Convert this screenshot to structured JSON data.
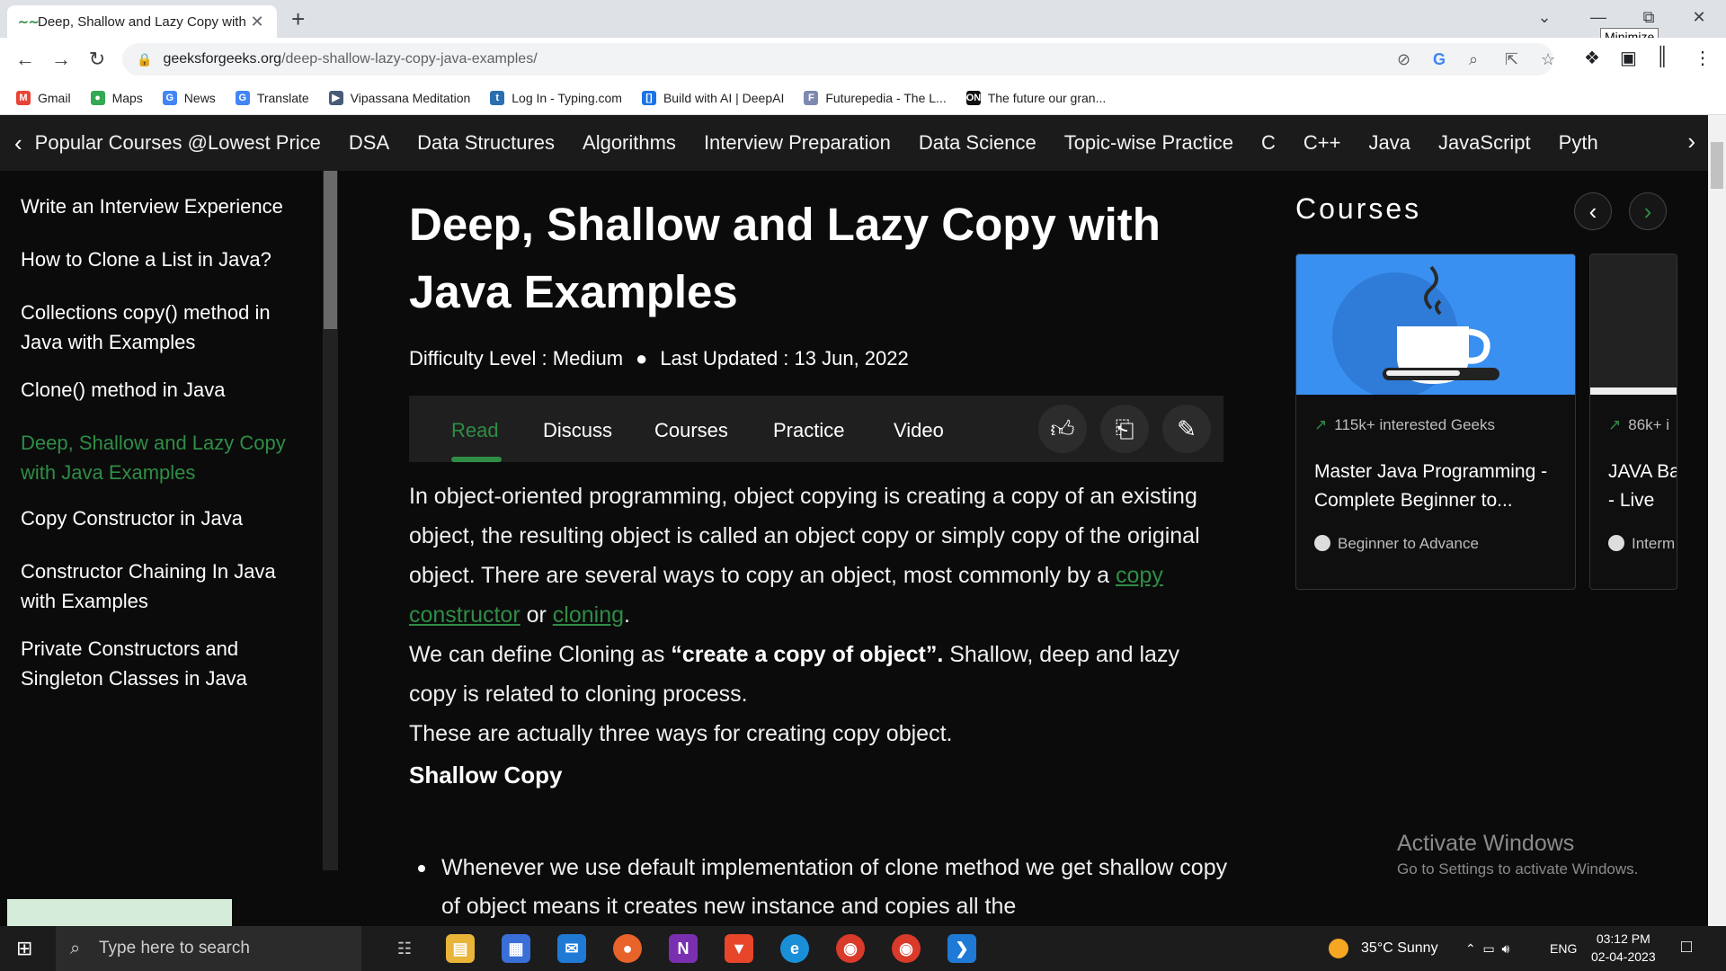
{
  "browser": {
    "tab_title": "Deep, Shallow and Lazy Copy with Java Examples",
    "tab_icon": "gfg-favicon",
    "new_tab": "+",
    "close_tab": "✕",
    "tooltip": "Minimize",
    "url_host": "geeksforgeeks.org",
    "url_path": "/deep-shallow-lazy-copy-java-examples/"
  },
  "bookmarks": [
    {
      "label": "Gmail",
      "icon": "gmail-icon",
      "color": "#ea4335",
      "glyph": "M"
    },
    {
      "label": "Maps",
      "icon": "maps-icon",
      "color": "#34a853",
      "glyph": "●"
    },
    {
      "label": "News",
      "icon": "news-icon",
      "color": "#4285f4",
      "glyph": "G"
    },
    {
      "label": "Translate",
      "icon": "translate-icon",
      "color": "#4285f4",
      "glyph": "G"
    },
    {
      "label": "Vipassana Meditation",
      "icon": "vipassana-icon",
      "color": "#4a5b7a",
      "glyph": "▶"
    },
    {
      "label": "Log In - Typing.com",
      "icon": "typing-icon",
      "color": "#2a6fb0",
      "glyph": "t"
    },
    {
      "label": "Build with AI | DeepAI",
      "icon": "deepai-icon",
      "color": "#1a73e8",
      "glyph": "[]"
    },
    {
      "label": "Futurepedia - The L...",
      "icon": "futurepedia-icon",
      "color": "#7d8ab0",
      "glyph": "F"
    },
    {
      "label": "The future our gran...",
      "icon": "on-icon",
      "color": "#111111",
      "glyph": "ON"
    }
  ],
  "gfg_nav": [
    "Popular Courses @Lowest Price",
    "DSA",
    "Data Structures",
    "Algorithms",
    "Interview Preparation",
    "Data Science",
    "Topic-wise Practice",
    "C",
    "C++",
    "Java",
    "JavaScript",
    "Pyth"
  ],
  "sidebar": [
    {
      "label": "Write an Interview Experience",
      "active": false
    },
    {
      "label": "How to Clone a List in Java?",
      "active": false
    },
    {
      "label": "Collections copy() method in Java with Examples",
      "active": false
    },
    {
      "label": "Clone() method in Java",
      "active": false
    },
    {
      "label": "Deep, Shallow and Lazy Copy with Java Examples",
      "active": true
    },
    {
      "label": "Copy Constructor in Java",
      "active": false
    },
    {
      "label": "Constructor Chaining In Java with Examples",
      "active": false
    },
    {
      "label": "Private Constructors and Singleton Classes in Java",
      "active": false
    }
  ],
  "article": {
    "title": "Deep, Shallow and Lazy Copy with Java Examples",
    "difficulty": "Difficulty Level : Medium",
    "updated": "Last Updated : 13 Jun, 2022",
    "tabs": [
      "Read",
      "Discuss",
      "Courses",
      "Practice",
      "Video"
    ],
    "p1_a": "In object-oriented programming, object copying is creating a copy of an existing object, the resulting object is called an object copy or simply copy of the original object. There are several ways to copy an object, most commonly by a ",
    "p1_link1": "copy constructor",
    "p1_or": " or ",
    "p1_link2": "cloning",
    "p1_end": ".",
    "p2_a": "We can define Cloning as ",
    "p2_bold": "“create a copy of object”.",
    "p2_b": " Shallow, deep and lazy copy is related to cloning process.",
    "p3": "These are actually three ways for creating copy object.",
    "subhead": "Shallow Copy",
    "bullet": "Whenever we use default implementation of clone method we get shallow copy of object means it creates new instance and copies all the"
  },
  "courses": {
    "heading": "Courses",
    "cards": [
      {
        "stat": "115k+ interested Geeks",
        "title": "Master Java Programming - Complete Beginner to...",
        "level": "Beginner to Advance"
      },
      {
        "stat": "86k+ i",
        "title": "JAVA Ba - Live",
        "level": "Interm"
      }
    ]
  },
  "watermark": {
    "line1": "Activate Windows",
    "line2": "Go to Settings to activate Windows."
  },
  "taskbar": {
    "search_placeholder": "Type here to search",
    "weather": "35°C  Sunny",
    "lang": "ENG",
    "time": "03:12 PM",
    "date": "02-04-2023"
  },
  "colors": {
    "accent": "#2f8d46",
    "background": "#0b0b0b",
    "nav_bg": "#1b1b1c"
  }
}
